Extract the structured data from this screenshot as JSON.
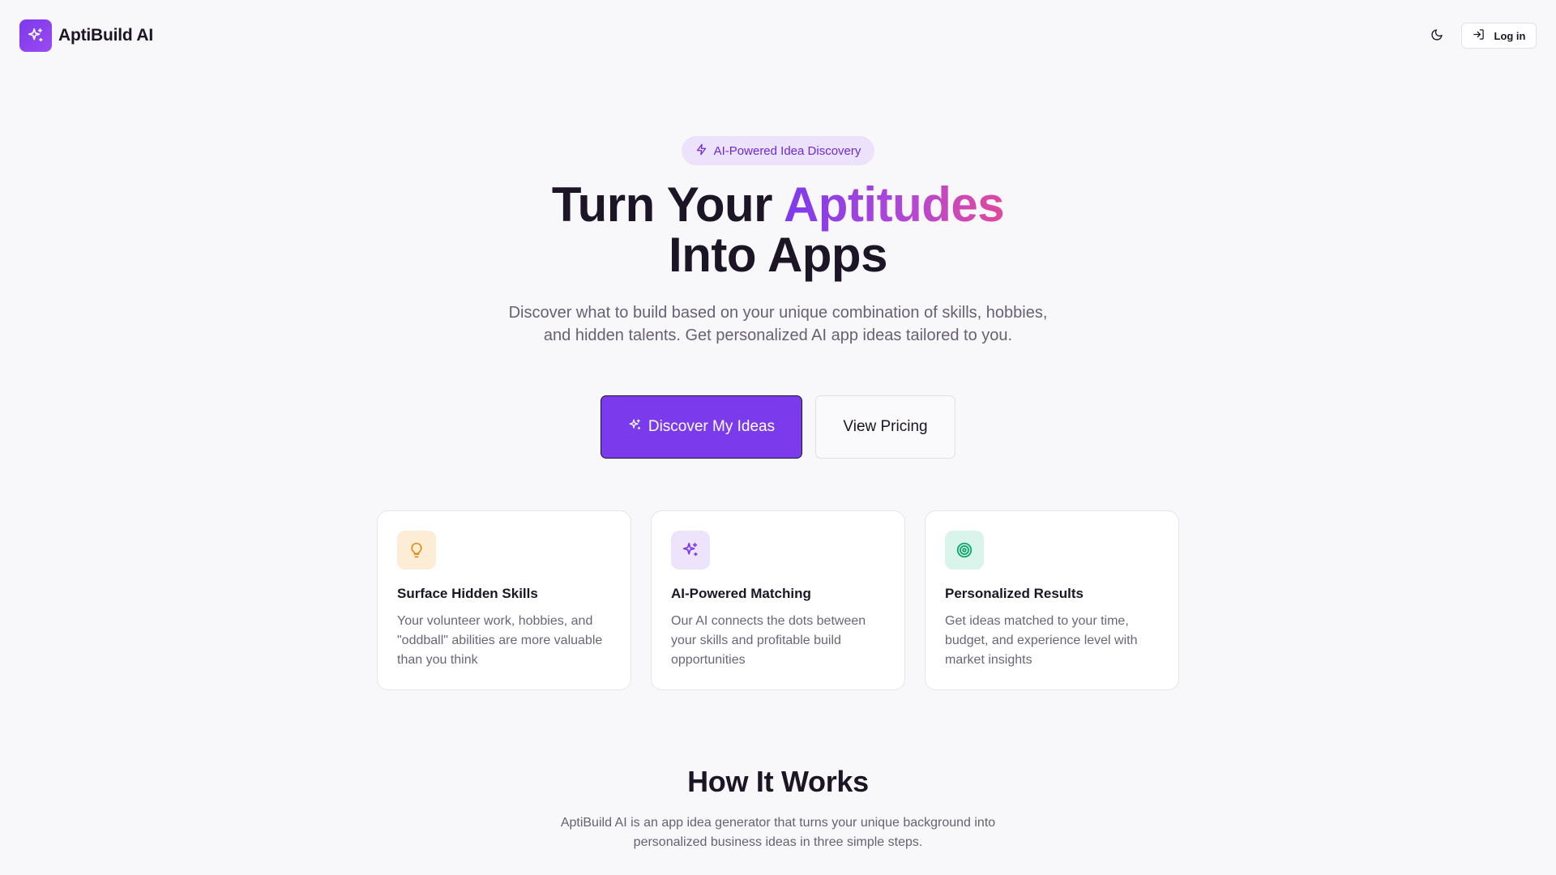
{
  "header": {
    "brand_name": "AptiBuild AI",
    "login_label": "Log in"
  },
  "hero": {
    "badge": "AI-Powered Idea Discovery",
    "title_part1": "Turn Your ",
    "title_highlight": "Aptitudes",
    "title_part2": "Into Apps",
    "subtitle": "Discover what to build based on your unique combination of skills, hobbies, and hidden talents. Get personalized AI app ideas tailored to you.",
    "primary_cta": "Discover My Ideas",
    "secondary_cta": "View Pricing"
  },
  "features": [
    {
      "icon": "lightbulb-icon",
      "title": "Surface Hidden Skills",
      "description": "Your volunteer work, hobbies, and \"oddball\" abilities are more valuable than you think"
    },
    {
      "icon": "sparkles-icon",
      "title": "AI-Powered Matching",
      "description": "Our AI connects the dots between your skills and profitable build opportunities"
    },
    {
      "icon": "target-icon",
      "title": "Personalized Results",
      "description": "Get ideas matched to your time, budget, and experience level with market insights"
    }
  ],
  "how_it_works": {
    "title": "How It Works",
    "subtitle": "AptiBuild AI is an app idea generator that turns your unique background into personalized business ideas in three simple steps."
  },
  "colors": {
    "accent": "#7c3aed",
    "amber_icon_bg": "#fdecd6",
    "violet_icon_bg": "#ede4fb",
    "green_icon_bg": "#d9f4ea"
  }
}
